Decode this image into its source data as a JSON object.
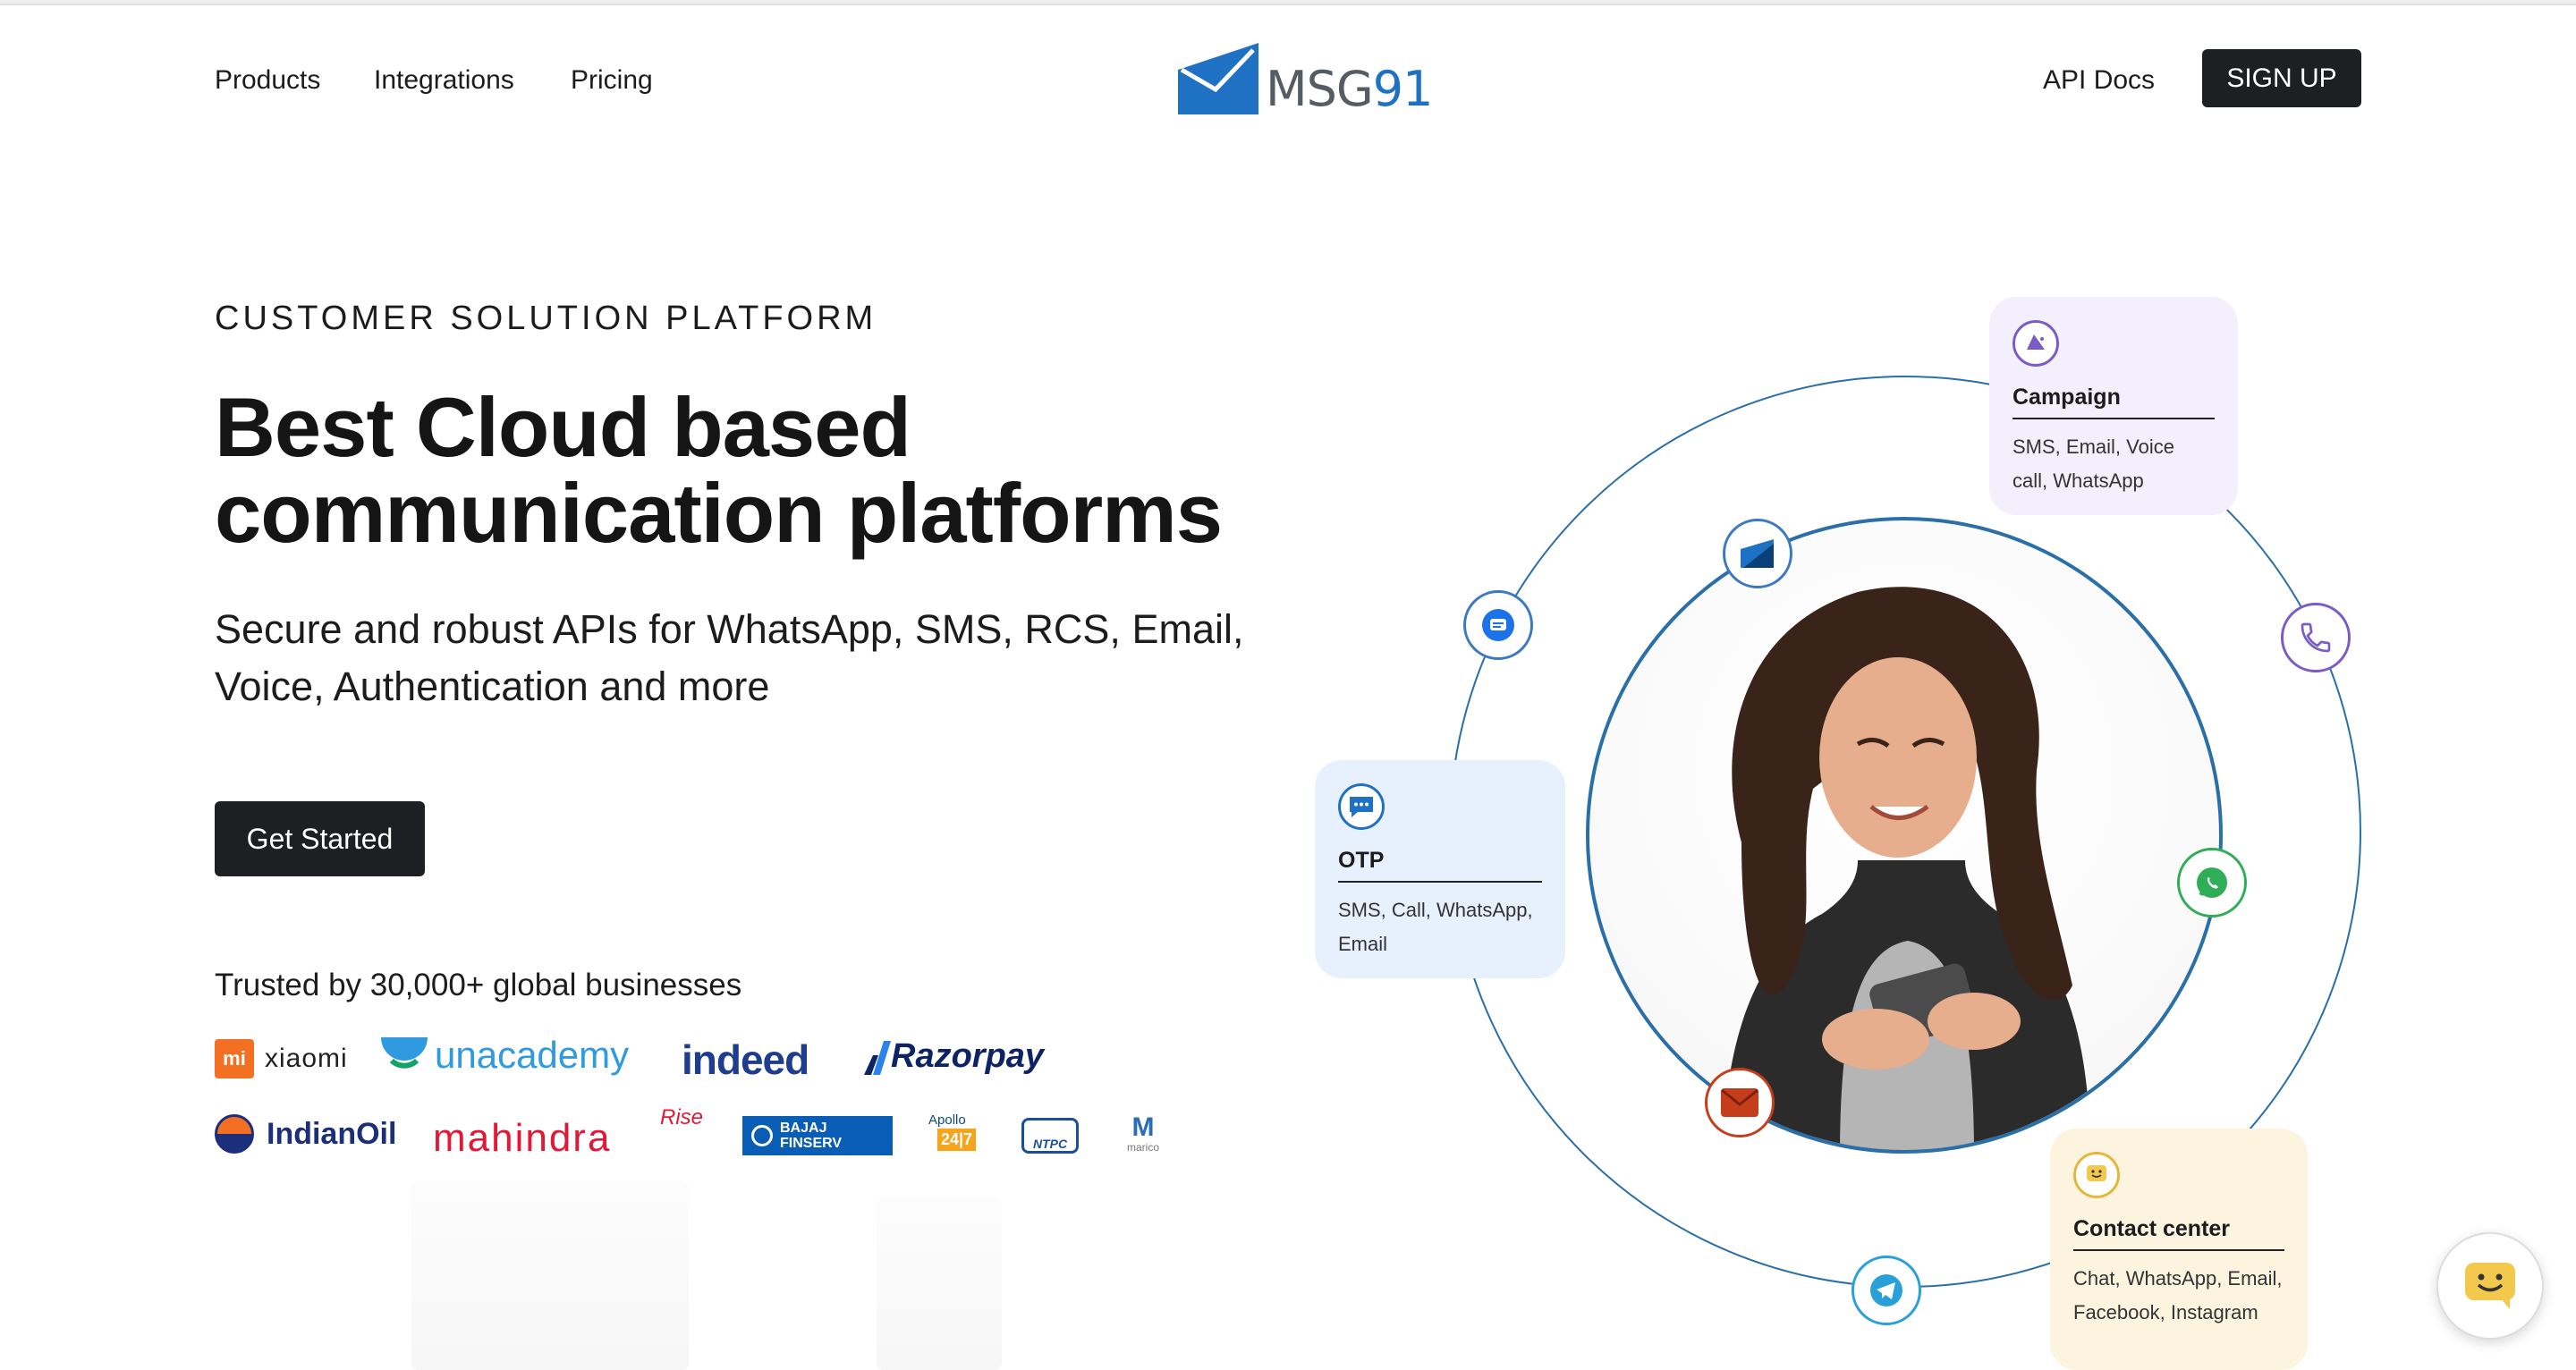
{
  "nav": {
    "products": "Products",
    "integrations": "Integrations",
    "pricing": "Pricing",
    "api_docs": "API Docs",
    "signup": "SIGN UP"
  },
  "logo": {
    "text": "MSG",
    "num": "91"
  },
  "hero": {
    "eyebrow": "CUSTOMER SOLUTION PLATFORM",
    "headline_line1": "Best Cloud based",
    "headline_line2": "communication platforms",
    "subhead_line1": "Secure and robust APIs for WhatsApp, SMS, RCS, Email,",
    "subhead_line2": "Voice, Authentication and more",
    "cta": "Get Started",
    "trusted": "Trusted by 30,000+ global businesses"
  },
  "brands": {
    "xiaomi": "xiaomi",
    "unacademy": "unacademy",
    "indeed": "indeed",
    "razorpay": "Razorpay",
    "indianoil": "IndianOil",
    "mahindra": "mahindra",
    "mahindra_rise": "Rise",
    "bajaj_1": "BAJAJ",
    "bajaj_2": "FINSERV",
    "apollo": "Apollo",
    "apollo_247": "24|7",
    "ntpc": "NTPC",
    "marico": "marico"
  },
  "cards": {
    "campaign": {
      "title": "Campaign",
      "desc": "SMS, Email, Voice call, WhatsApp"
    },
    "otp": {
      "title": "OTP",
      "desc": "SMS, Call, WhatsApp, Email"
    },
    "contact": {
      "title": "Contact center",
      "desc": "Chat, WhatsApp, Email, Facebook, Instagram"
    }
  },
  "icons": {
    "orbit": [
      "rcs-icon",
      "msg91-icon",
      "phone-icon",
      "whatsapp-icon",
      "email-icon",
      "telegram-icon"
    ],
    "cards": [
      "megaphone-icon",
      "chat-dots-icon",
      "smiley-chat-icon"
    ],
    "widget": "smiley-chat-icon"
  },
  "colors": {
    "accent_dark": "#1e1f23",
    "orbit_blue": "#2a6fa8",
    "campaign_bg": "#f3effd",
    "otp_bg": "#e7f1fd",
    "contact_bg": "#fdf4df",
    "whatsapp": "#2fae57",
    "email": "#c43e1c",
    "telegram": "#2aa0da"
  }
}
